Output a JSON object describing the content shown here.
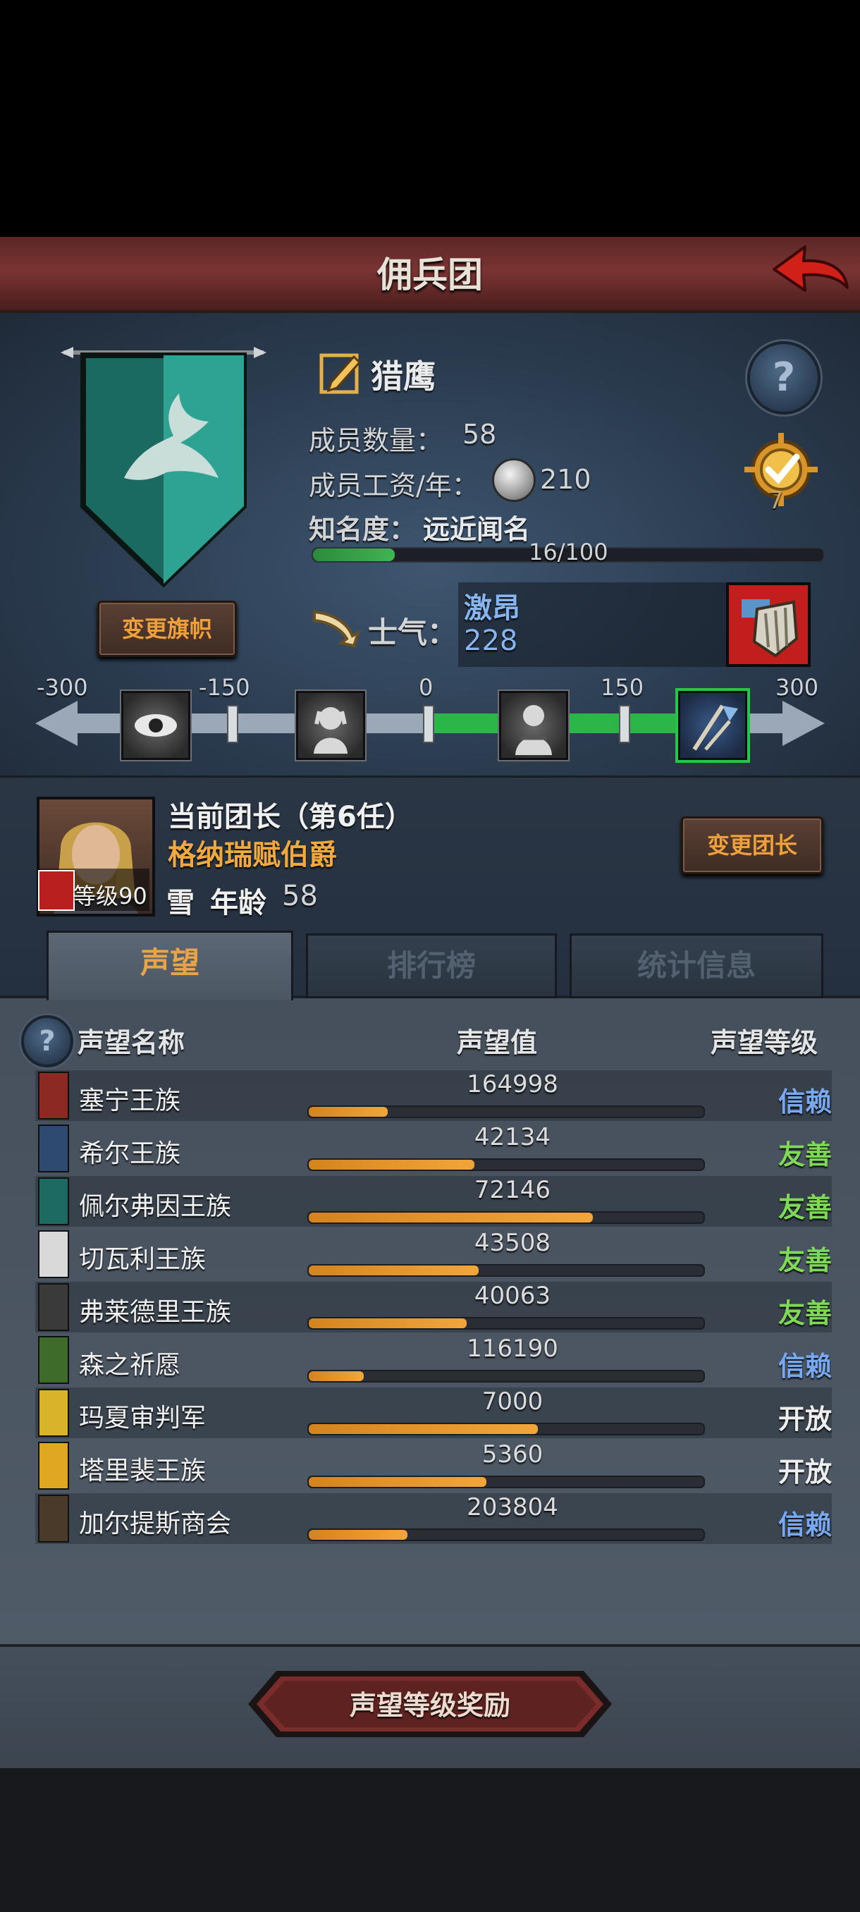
{
  "header": {
    "title": "佣兵团"
  },
  "company": {
    "name": "猎鹰",
    "members_label": "成员数量：",
    "members_value": "58",
    "salary_label": "成员工资/年：",
    "salary_value": "210",
    "fame_label": "知名度：",
    "fame_value": "远近闻名",
    "fame_progress": "16/100",
    "fame_fraction": 0.16,
    "change_banner_label": "变更旗帜",
    "badge_count": "7",
    "banner_color": "#2b9a8e"
  },
  "morale": {
    "label": "士气：",
    "state": "激昂",
    "value": "228",
    "ticks": [
      "-300",
      "-150",
      "0",
      "150",
      "300"
    ]
  },
  "leader": {
    "title": "当前团长（第6任）",
    "name": "格纳瑞赋伯爵",
    "level_label": "等级90",
    "trait": "雪",
    "age_label": "年龄",
    "age_value": "58",
    "change_label": "变更团长"
  },
  "tabs": [
    {
      "label": "声望",
      "active": true
    },
    {
      "label": "排行榜",
      "active": false
    },
    {
      "label": "统计信息",
      "active": false
    }
  ],
  "reputation": {
    "col_name": "声望名称",
    "col_value": "声望值",
    "col_level": "声望等级",
    "rows": [
      {
        "name": "塞宁王族",
        "value": "164998",
        "fill": 0.2,
        "level": "信赖",
        "tone": "blue",
        "color": "#8a2a22"
      },
      {
        "name": "希尔王族",
        "value": "42134",
        "fill": 0.42,
        "level": "友善",
        "tone": "green",
        "color": "#2e4a70"
      },
      {
        "name": "佩尔弗因王族",
        "value": "72146",
        "fill": 0.72,
        "level": "友善",
        "tone": "green",
        "color": "#1d6a62"
      },
      {
        "name": "切瓦利王族",
        "value": "43508",
        "fill": 0.43,
        "level": "友善",
        "tone": "green",
        "color": "#d9d9d9"
      },
      {
        "name": "弗莱德里王族",
        "value": "40063",
        "fill": 0.4,
        "level": "友善",
        "tone": "green",
        "color": "#3a3a3a"
      },
      {
        "name": "森之祈愿",
        "value": "116190",
        "fill": 0.14,
        "level": "信赖",
        "tone": "blue",
        "color": "#3e6a2a"
      },
      {
        "name": "玛夏审判军",
        "value": "7000",
        "fill": 0.58,
        "level": "开放",
        "tone": "white",
        "color": "#d9b42a"
      },
      {
        "name": "塔里裴王族",
        "value": "5360",
        "fill": 0.45,
        "level": "开放",
        "tone": "white",
        "color": "#e0a820"
      },
      {
        "name": "加尔提斯商会",
        "value": "203804",
        "fill": 0.25,
        "level": "信赖",
        "tone": "blue",
        "color": "#4a3a2a"
      }
    ]
  },
  "reward_button": {
    "label": "声望等级奖励"
  }
}
